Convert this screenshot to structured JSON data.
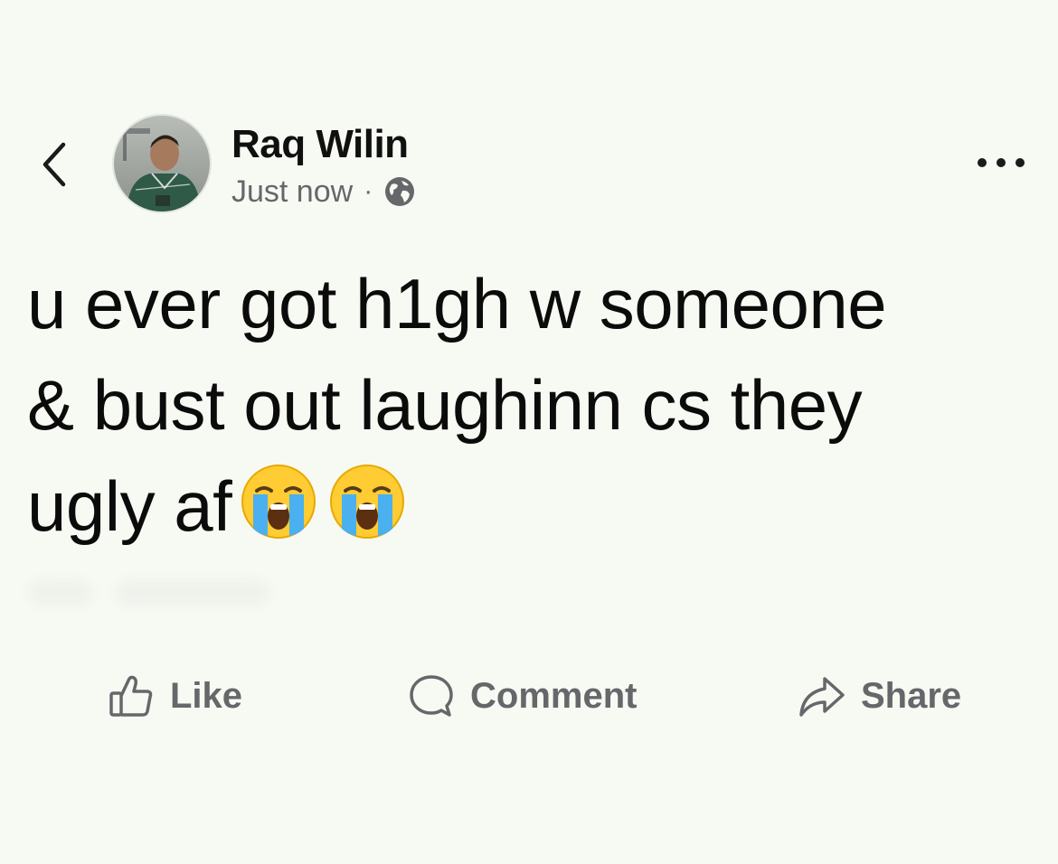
{
  "post": {
    "author": "Raq Wilin",
    "timestamp": "Just now",
    "separator": "·",
    "privacy_icon": "globe-icon",
    "text_lines": [
      "u ever got h1gh w someone",
      "& bust out laughinn cs they",
      "ugly af"
    ],
    "emojis": [
      "loudly-crying-face",
      "loudly-crying-face"
    ]
  },
  "header": {
    "back_icon": "chevron-left-icon",
    "more_icon": "more-horizontal-icon"
  },
  "actions": {
    "like_label": "Like",
    "comment_label": "Comment",
    "share_label": "Share"
  },
  "colors": {
    "background": "#f7faf2",
    "text": "#0b0b0b",
    "secondary": "#65676b"
  }
}
